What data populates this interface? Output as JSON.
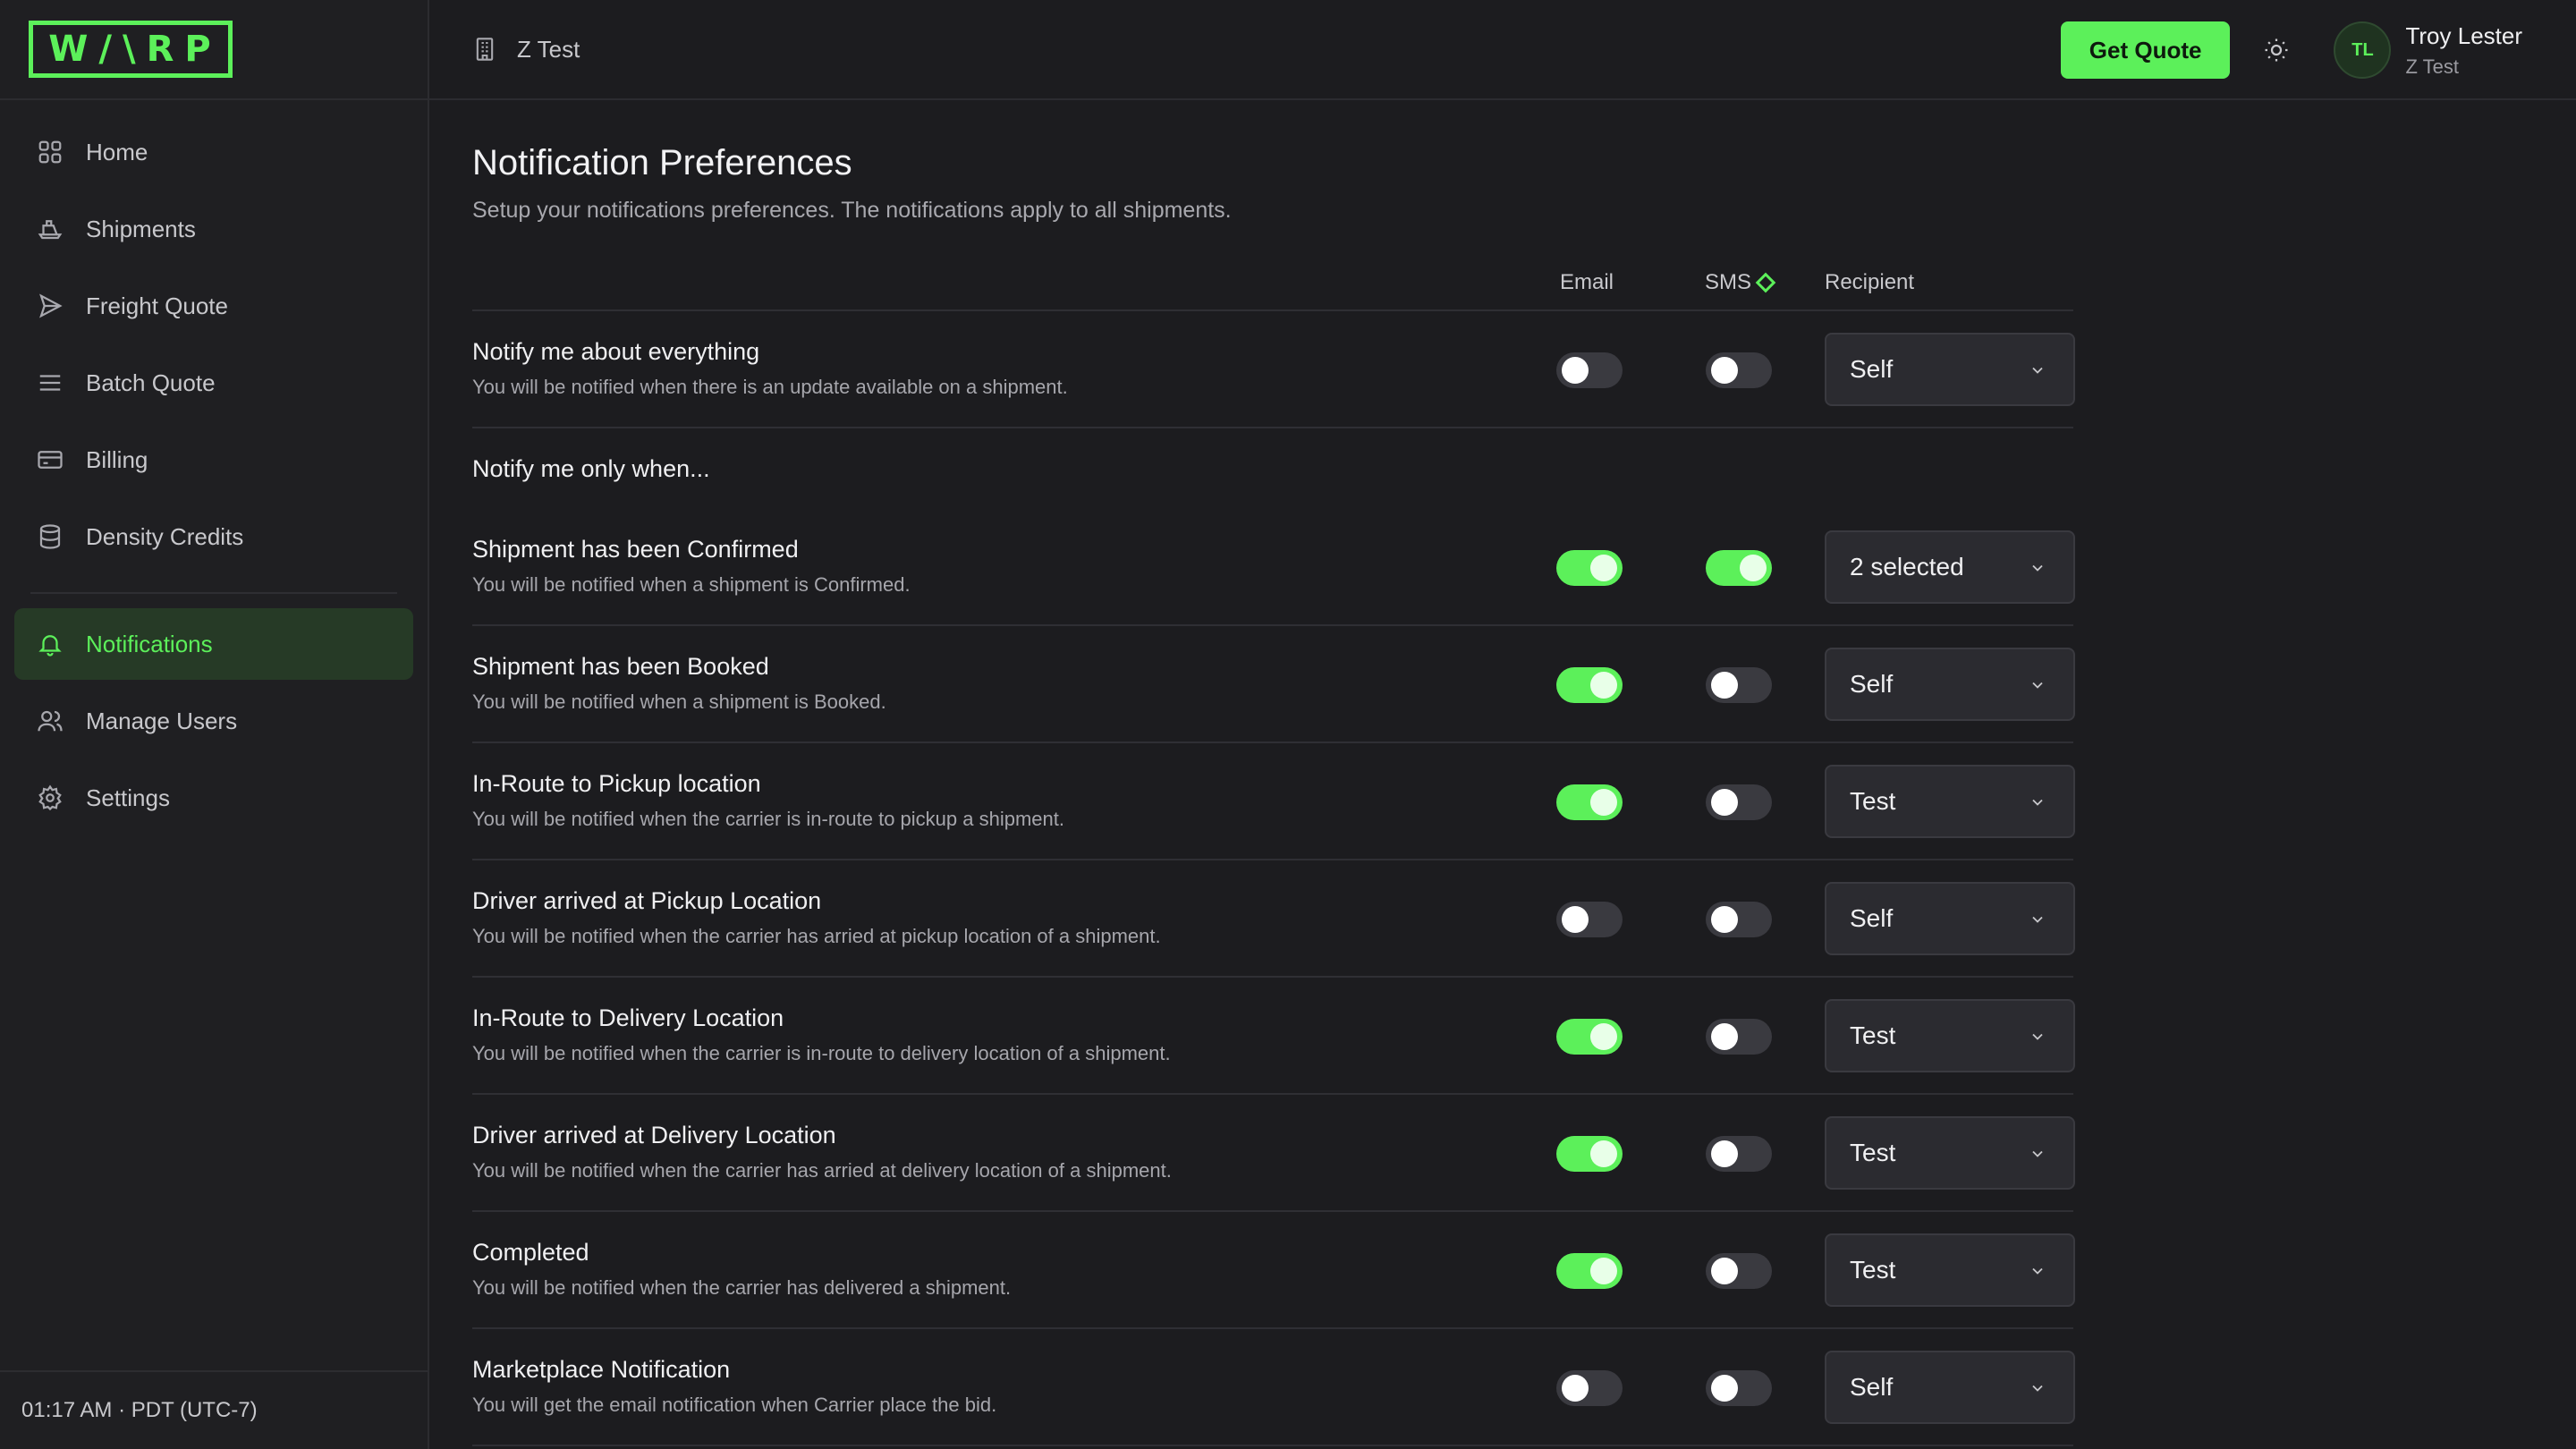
{
  "brand": {
    "logo_text": "W/\\RP",
    "accent": "#5cf05a"
  },
  "sidebar": {
    "items": [
      {
        "label": "Home",
        "icon": "grid-icon"
      },
      {
        "label": "Shipments",
        "icon": "ship-icon"
      },
      {
        "label": "Freight Quote",
        "icon": "send-icon"
      },
      {
        "label": "Batch Quote",
        "icon": "list-icon"
      },
      {
        "label": "Billing",
        "icon": "card-icon"
      },
      {
        "label": "Density Credits",
        "icon": "database-icon"
      }
    ],
    "secondary": [
      {
        "label": "Notifications",
        "icon": "bell-icon",
        "active": true
      },
      {
        "label": "Manage Users",
        "icon": "users-icon"
      },
      {
        "label": "Settings",
        "icon": "gear-icon"
      }
    ],
    "footer_time": "01:17 AM · PDT (UTC-7)"
  },
  "header": {
    "org_name": "Z Test",
    "get_quote_label": "Get Quote",
    "user": {
      "initials": "TL",
      "name": "Troy Lester",
      "org": "Z Test"
    }
  },
  "page": {
    "title": "Notification Preferences",
    "subtitle": "Setup your notifications preferences. The notifications apply to all shipments."
  },
  "table": {
    "columns": {
      "email": "Email",
      "sms": "SMS",
      "recipient": "Recipient"
    },
    "top_row": {
      "title": "Notify me about everything",
      "desc": "You will be notified when there is an update available on a shipment.",
      "email": false,
      "sms": false,
      "recipient": "Self"
    },
    "section_title": "Notify me only when...",
    "rows": [
      {
        "title": "Shipment has been Confirmed",
        "desc": "You will be notified when a shipment is Confirmed.",
        "email": true,
        "sms": true,
        "recipient": "2 selected"
      },
      {
        "title": "Shipment has been Booked",
        "desc": "You will be notified when a shipment is Booked.",
        "email": true,
        "sms": false,
        "recipient": "Self"
      },
      {
        "title": "In-Route to Pickup location",
        "desc": "You will be notified when the carrier is in-route to pickup a shipment.",
        "email": true,
        "sms": false,
        "recipient": "Test"
      },
      {
        "title": "Driver arrived at Pickup Location",
        "desc": "You will be notified when the carrier has arried at pickup location of a shipment.",
        "email": false,
        "sms": false,
        "recipient": "Self"
      },
      {
        "title": "In-Route to Delivery Location",
        "desc": "You will be notified when the carrier is in-route to delivery location of a shipment.",
        "email": true,
        "sms": false,
        "recipient": "Test"
      },
      {
        "title": "Driver arrived at Delivery Location",
        "desc": "You will be notified when the carrier has arried at delivery location of a shipment.",
        "email": true,
        "sms": false,
        "recipient": "Test"
      },
      {
        "title": "Completed",
        "desc": "You will be notified when the carrier has delivered a shipment.",
        "email": true,
        "sms": false,
        "recipient": "Test"
      },
      {
        "title": "Marketplace Notification",
        "desc": "You will get the email notification when Carrier place the bid.",
        "email": false,
        "sms": false,
        "recipient": "Self"
      }
    ]
  }
}
